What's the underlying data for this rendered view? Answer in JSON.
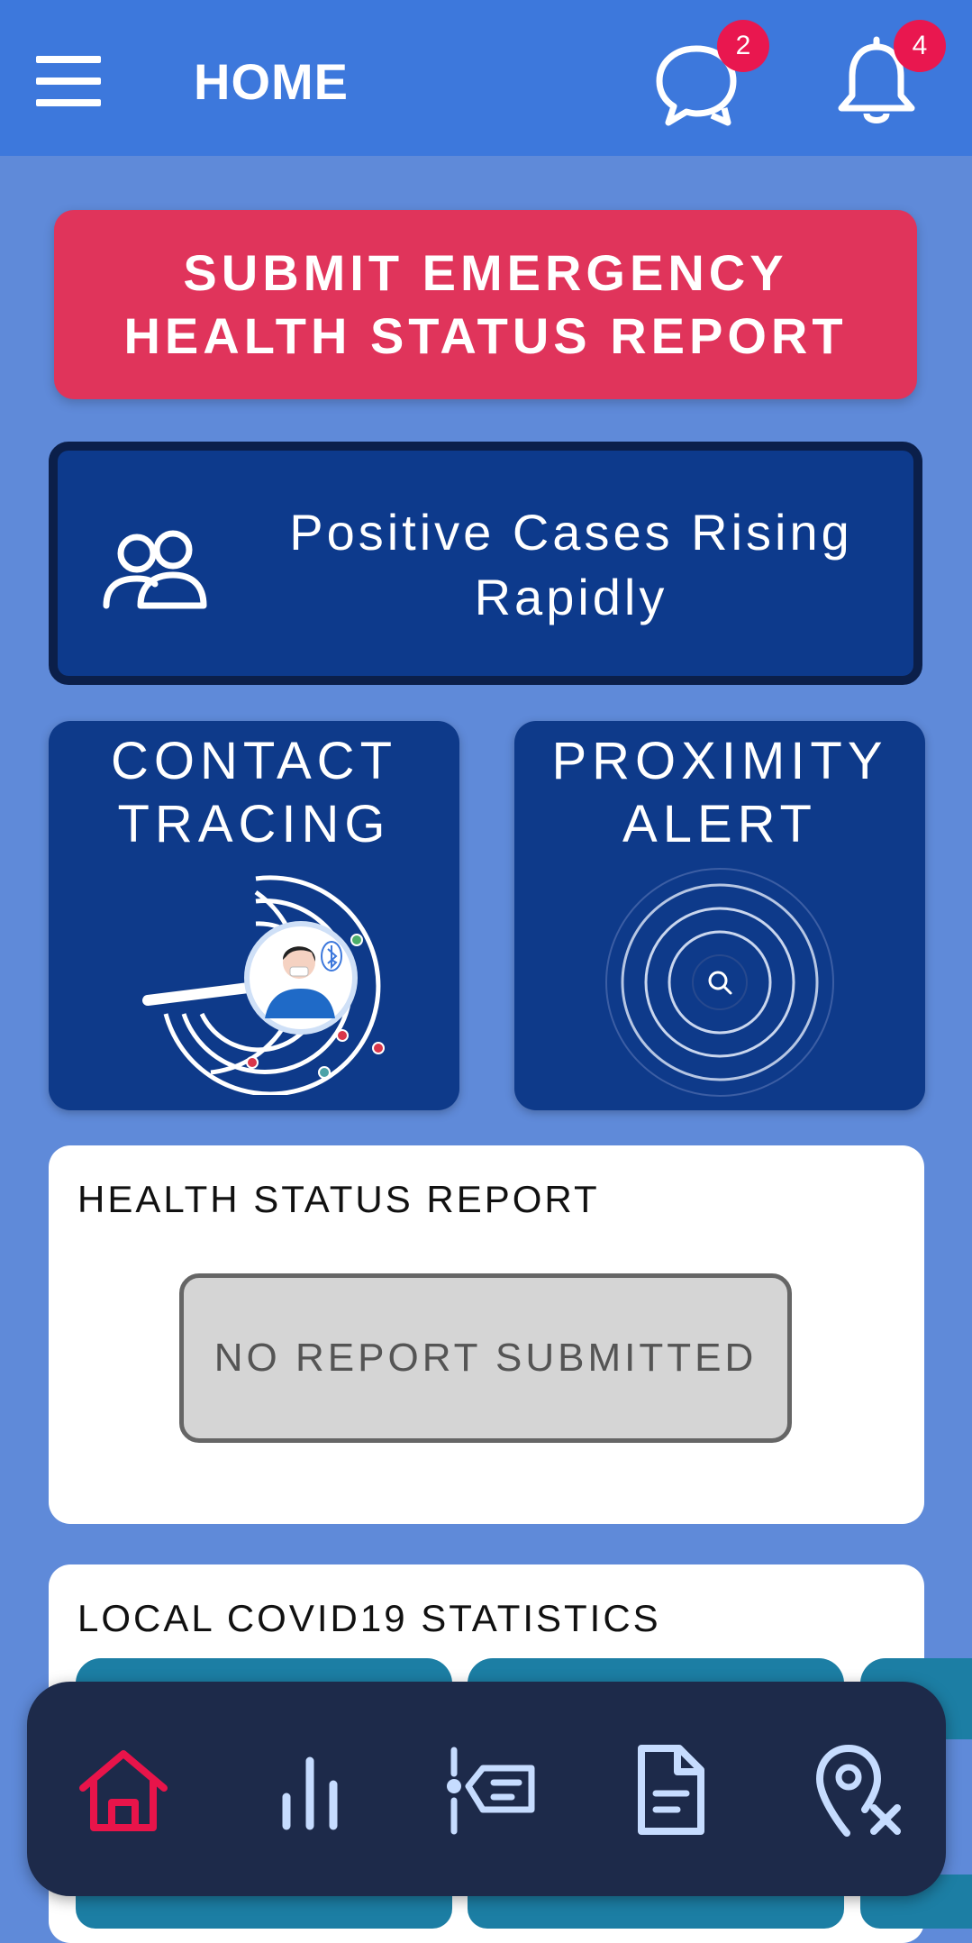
{
  "header": {
    "title": "HOME",
    "messages_badge": "2",
    "notifications_badge": "4"
  },
  "emergency_button": {
    "line1": "SUBMIT EMERGENCY",
    "line2": "HEALTH STATUS REPORT"
  },
  "cases_banner": {
    "line1": "Positive Cases Rising",
    "line2": "Rapidly"
  },
  "tiles": {
    "contact_tracing": {
      "line1": "CONTACT",
      "line2": "TRACING"
    },
    "proximity_alert": {
      "line1": "PROXIMITY",
      "line2": "ALERT"
    }
  },
  "health_report": {
    "heading": "HEALTH STATUS REPORT",
    "status": "NO REPORT SUBMITTED"
  },
  "statistics": {
    "heading": "LOCAL COVID19 STATISTICS"
  },
  "nav": [
    {
      "icon": "home-icon",
      "active": true
    },
    {
      "icon": "bar-chart-icon",
      "active": false
    },
    {
      "icon": "list-icon",
      "active": false
    },
    {
      "icon": "document-icon",
      "active": false
    },
    {
      "icon": "location-off-icon",
      "active": false
    }
  ],
  "colors": {
    "background": "#5f8ad9",
    "appbar": "#3d78dc",
    "emergency": "#e0345b",
    "navy": "#0e3a8a",
    "nav_active": "#e8144a",
    "nav_inactive": "#c6dcff"
  }
}
